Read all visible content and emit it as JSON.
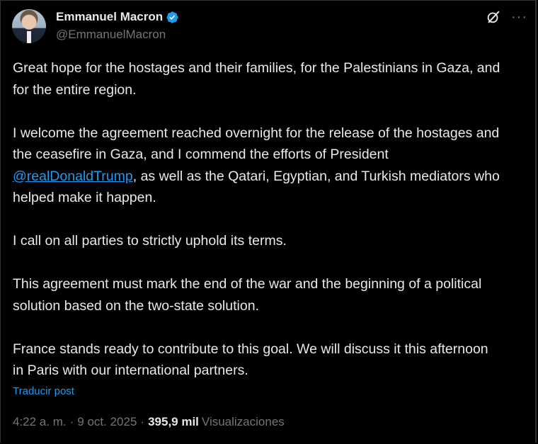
{
  "author": {
    "display_name": "Emmanuel Macron",
    "handle": "@EmmanuelMacron",
    "verified_icon": "verified-badge-icon"
  },
  "header_actions": {
    "grok_icon": "grok-icon",
    "more_label": "···"
  },
  "post": {
    "paragraphs": [
      {
        "text": "Great hope for the hostages and their families, for the Palestinians in Gaza, and for the entire region."
      },
      {
        "before": "I welcome the agreement reached overnight for the release of the hostages and the ceasefire in Gaza, and I commend the efforts of President ",
        "mention": "@realDonaldTrump",
        "after": ", as well as the Qatari, Egyptian, and Turkish mediators who helped make it happen."
      },
      {
        "text": "I call on all parties to strictly uphold its terms."
      },
      {
        "text": "This agreement must mark the end of the war and the beginning of a political solution based on the two-state solution."
      },
      {
        "text": "France stands ready to contribute to this goal. We will discuss it this afternoon in Paris with our international partners."
      }
    ],
    "translate_label": "Traducir post"
  },
  "meta": {
    "time": "4:22 a. m.",
    "date": "9 oct. 2025",
    "separator": "·",
    "views_count": "395,9 mil",
    "views_label": "Visualizaciones"
  },
  "colors": {
    "background": "#000000",
    "text": "#e7e9ea",
    "muted": "#71767b",
    "accent": "#1d9bf0"
  }
}
